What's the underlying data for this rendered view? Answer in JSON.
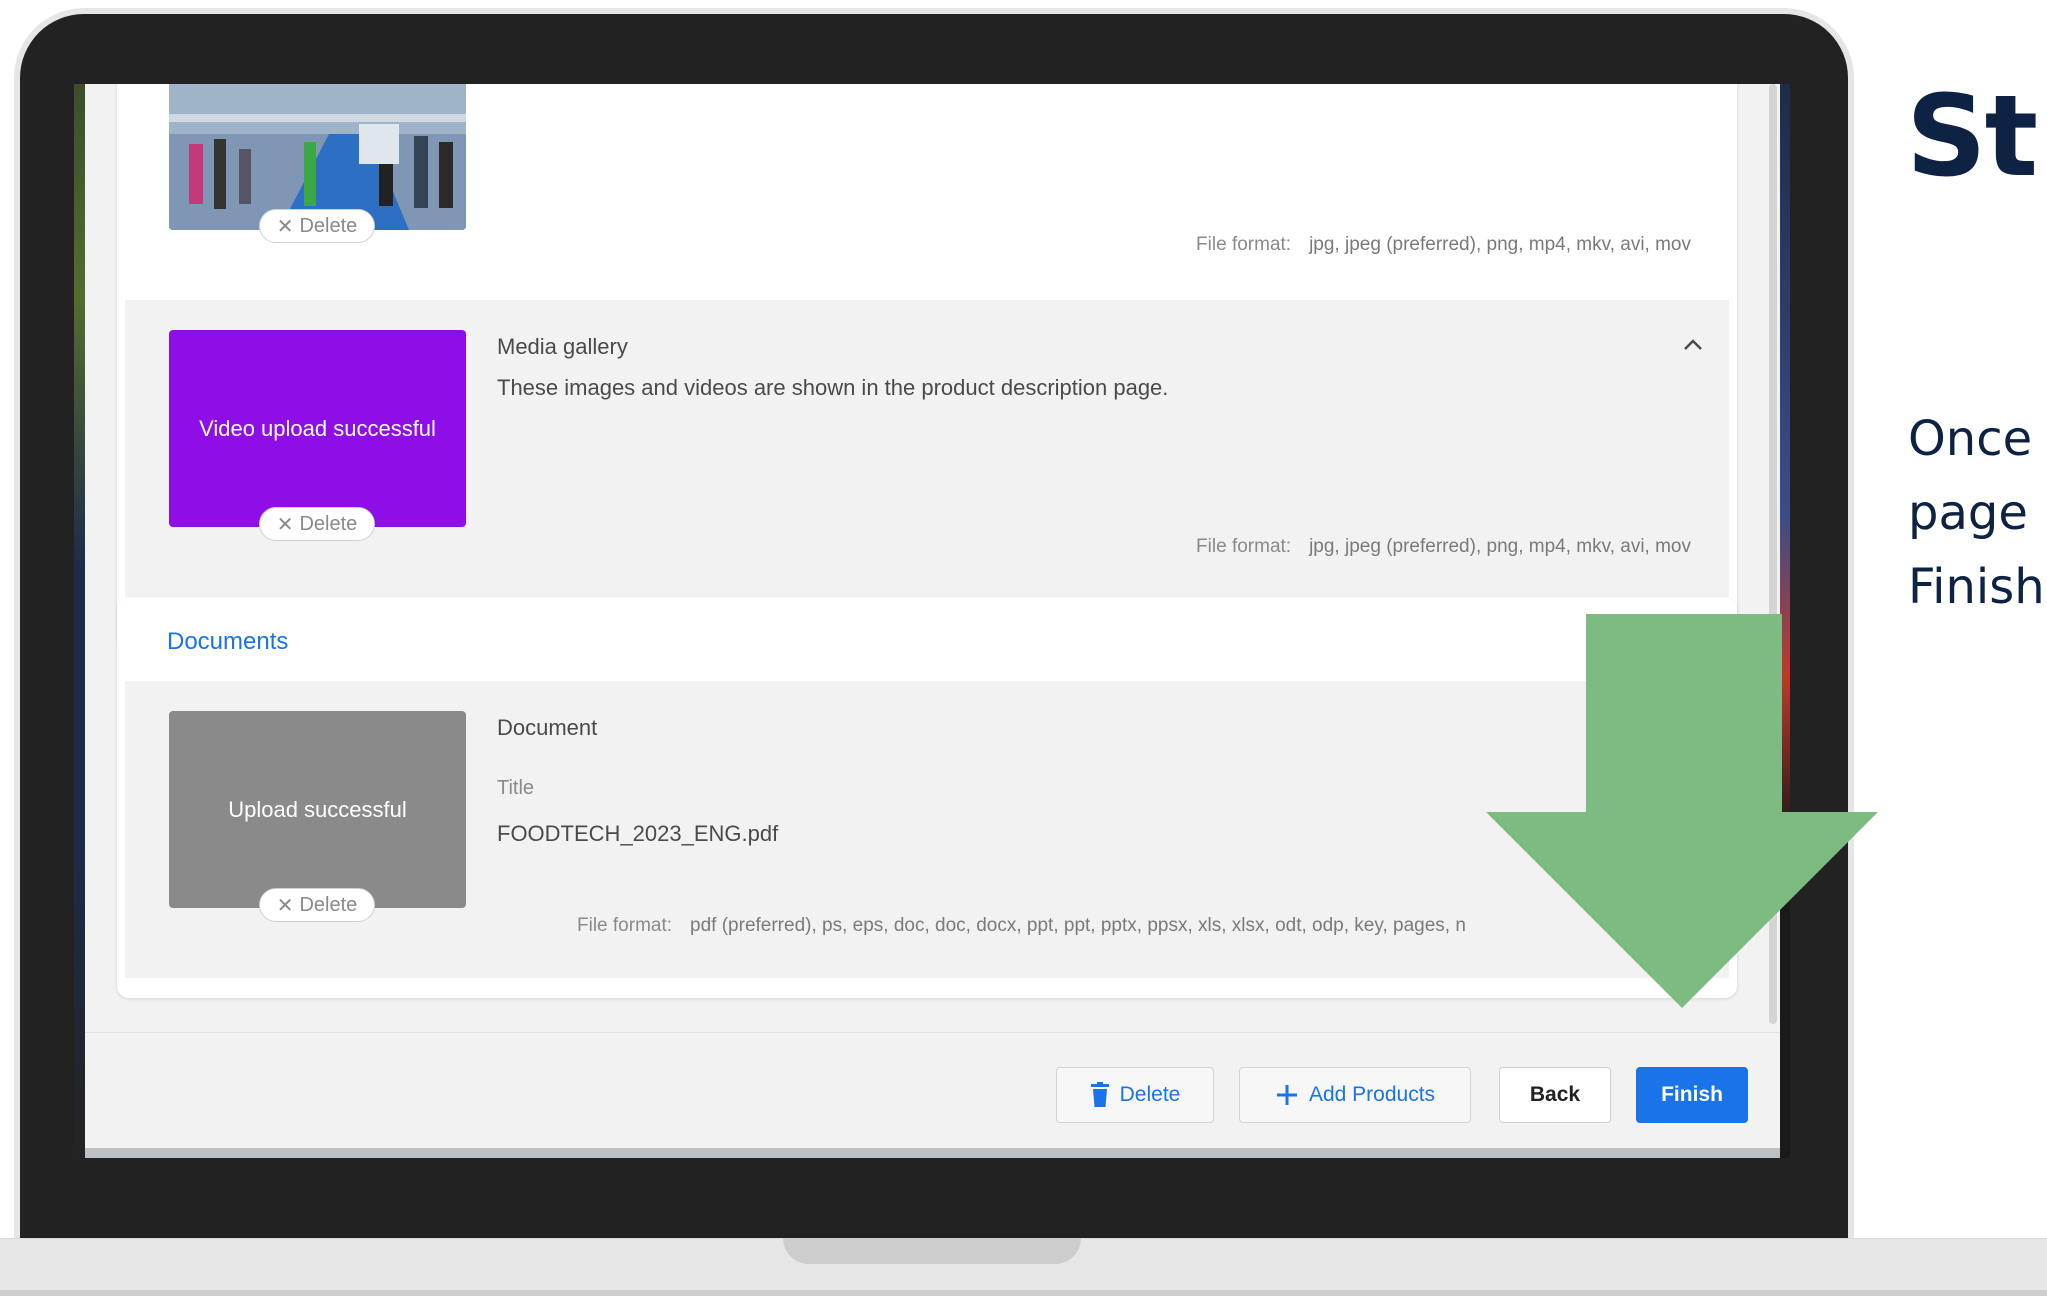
{
  "media": {
    "top_item": {
      "delete_label": "Delete",
      "file_format_label": "File format:",
      "file_format_value": "jpg, jpeg (preferred), png, mp4, mkv, avi, mov"
    },
    "gallery": {
      "title": "Media gallery",
      "description": "These images and videos are shown in the product description page.",
      "thumb_text": "Video upload successful",
      "delete_label": "Delete",
      "file_format_label": "File format:",
      "file_format_value": "jpg, jpeg (preferred), png, mp4, mkv, avi, mov",
      "collapse_icon": "chevron-up-icon"
    }
  },
  "documents": {
    "section_title": "Documents",
    "item": {
      "title": "Document",
      "thumb_text": "Upload successful",
      "delete_label": "Delete",
      "field_label": "Title",
      "field_value": "FOODTECH_2023_ENG.pdf",
      "file_format_label": "File format:",
      "file_format_value": "pdf (preferred), ps, eps, doc, doc, docx, ppt, ppt, pptx, ppsx, xls, xlsx, odt, odp, key, pages, n"
    }
  },
  "actions": {
    "delete_label": "Delete",
    "delete_icon": "trash-icon",
    "add_products_label": "Add Products",
    "add_icon": "plus-icon",
    "back_label": "Back",
    "finish_label": "Finish"
  },
  "slide": {
    "heading": "St",
    "body_line1": "Once",
    "body_line2": "page",
    "body_line3": "Finish"
  },
  "colors": {
    "accent_blue": "#1a73e8",
    "video_thumb": "#8f0ee8",
    "doc_thumb": "#8a8a8a",
    "arrow_green": "#7dbb82",
    "slide_text": "#0e2244"
  }
}
